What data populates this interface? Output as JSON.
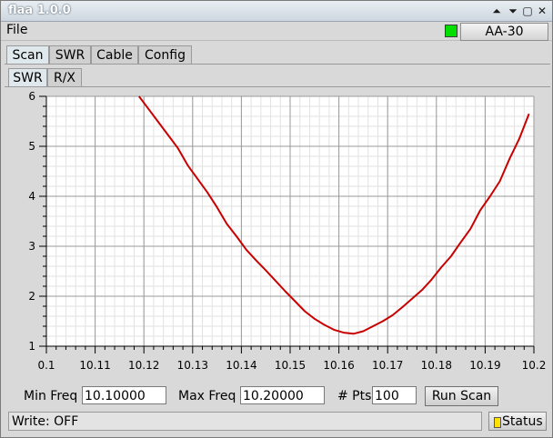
{
  "window": {
    "title": "flaa 1.0.0",
    "min_glyph": "⏶",
    "restore_glyph": "⏷",
    "max_glyph": "▢",
    "close_glyph": "✕"
  },
  "menu": {
    "file": "File"
  },
  "device": {
    "label": "AA-30",
    "led_color": "#00e000"
  },
  "tabs": [
    {
      "label": "Scan",
      "active": true
    },
    {
      "label": "SWR",
      "active": false
    },
    {
      "label": "Cable",
      "active": false
    },
    {
      "label": "Config",
      "active": false
    }
  ],
  "subtabs": [
    {
      "label": "SWR",
      "active": true
    },
    {
      "label": "R/X",
      "active": false
    }
  ],
  "controls": {
    "min_freq_label": "Min Freq",
    "min_freq_value": "10.10000",
    "max_freq_label": "Max Freq",
    "max_freq_value": "10.20000",
    "pts_label": "# Pts",
    "pts_value": "100",
    "run_label": "Run Scan"
  },
  "status": {
    "text": "Write: OFF",
    "button_label": "Status",
    "indicator_color": "#ffe000"
  },
  "chart_data": {
    "type": "line",
    "xlim": [
      10.1,
      10.2
    ],
    "ylim": [
      1,
      6
    ],
    "x_ticks": [
      "0.1",
      "10.11",
      "10.12",
      "10.13",
      "10.14",
      "10.15",
      "10.16",
      "10.17",
      "10.18",
      "10.19",
      "10.2"
    ],
    "y_ticks": [
      "1",
      "2",
      "3",
      "4",
      "5",
      "6"
    ],
    "grid": true,
    "line_color": "#c80000",
    "series": [
      {
        "x": [
          10.119,
          10.121,
          10.123,
          10.125,
          10.127,
          10.129,
          10.131,
          10.133,
          10.135,
          10.137,
          10.139,
          10.141,
          10.143,
          10.145,
          10.147,
          10.149,
          10.151,
          10.153,
          10.155,
          10.157,
          10.159,
          10.161,
          10.163,
          10.165,
          10.167,
          10.169,
          10.171,
          10.173,
          10.175,
          10.177,
          10.179,
          10.181,
          10.183,
          10.185,
          10.187,
          10.189,
          10.191,
          10.193,
          10.195,
          10.197,
          10.199
        ],
        "y": [
          6.0,
          5.74,
          5.48,
          5.22,
          4.96,
          4.62,
          4.35,
          4.08,
          3.78,
          3.45,
          3.2,
          2.93,
          2.72,
          2.52,
          2.31,
          2.1,
          1.9,
          1.7,
          1.55,
          1.43,
          1.33,
          1.27,
          1.25,
          1.3,
          1.4,
          1.5,
          1.62,
          1.78,
          1.95,
          2.12,
          2.33,
          2.58,
          2.8,
          3.08,
          3.35,
          3.72,
          4.0,
          4.3,
          4.75,
          5.15,
          5.65
        ]
      }
    ]
  }
}
